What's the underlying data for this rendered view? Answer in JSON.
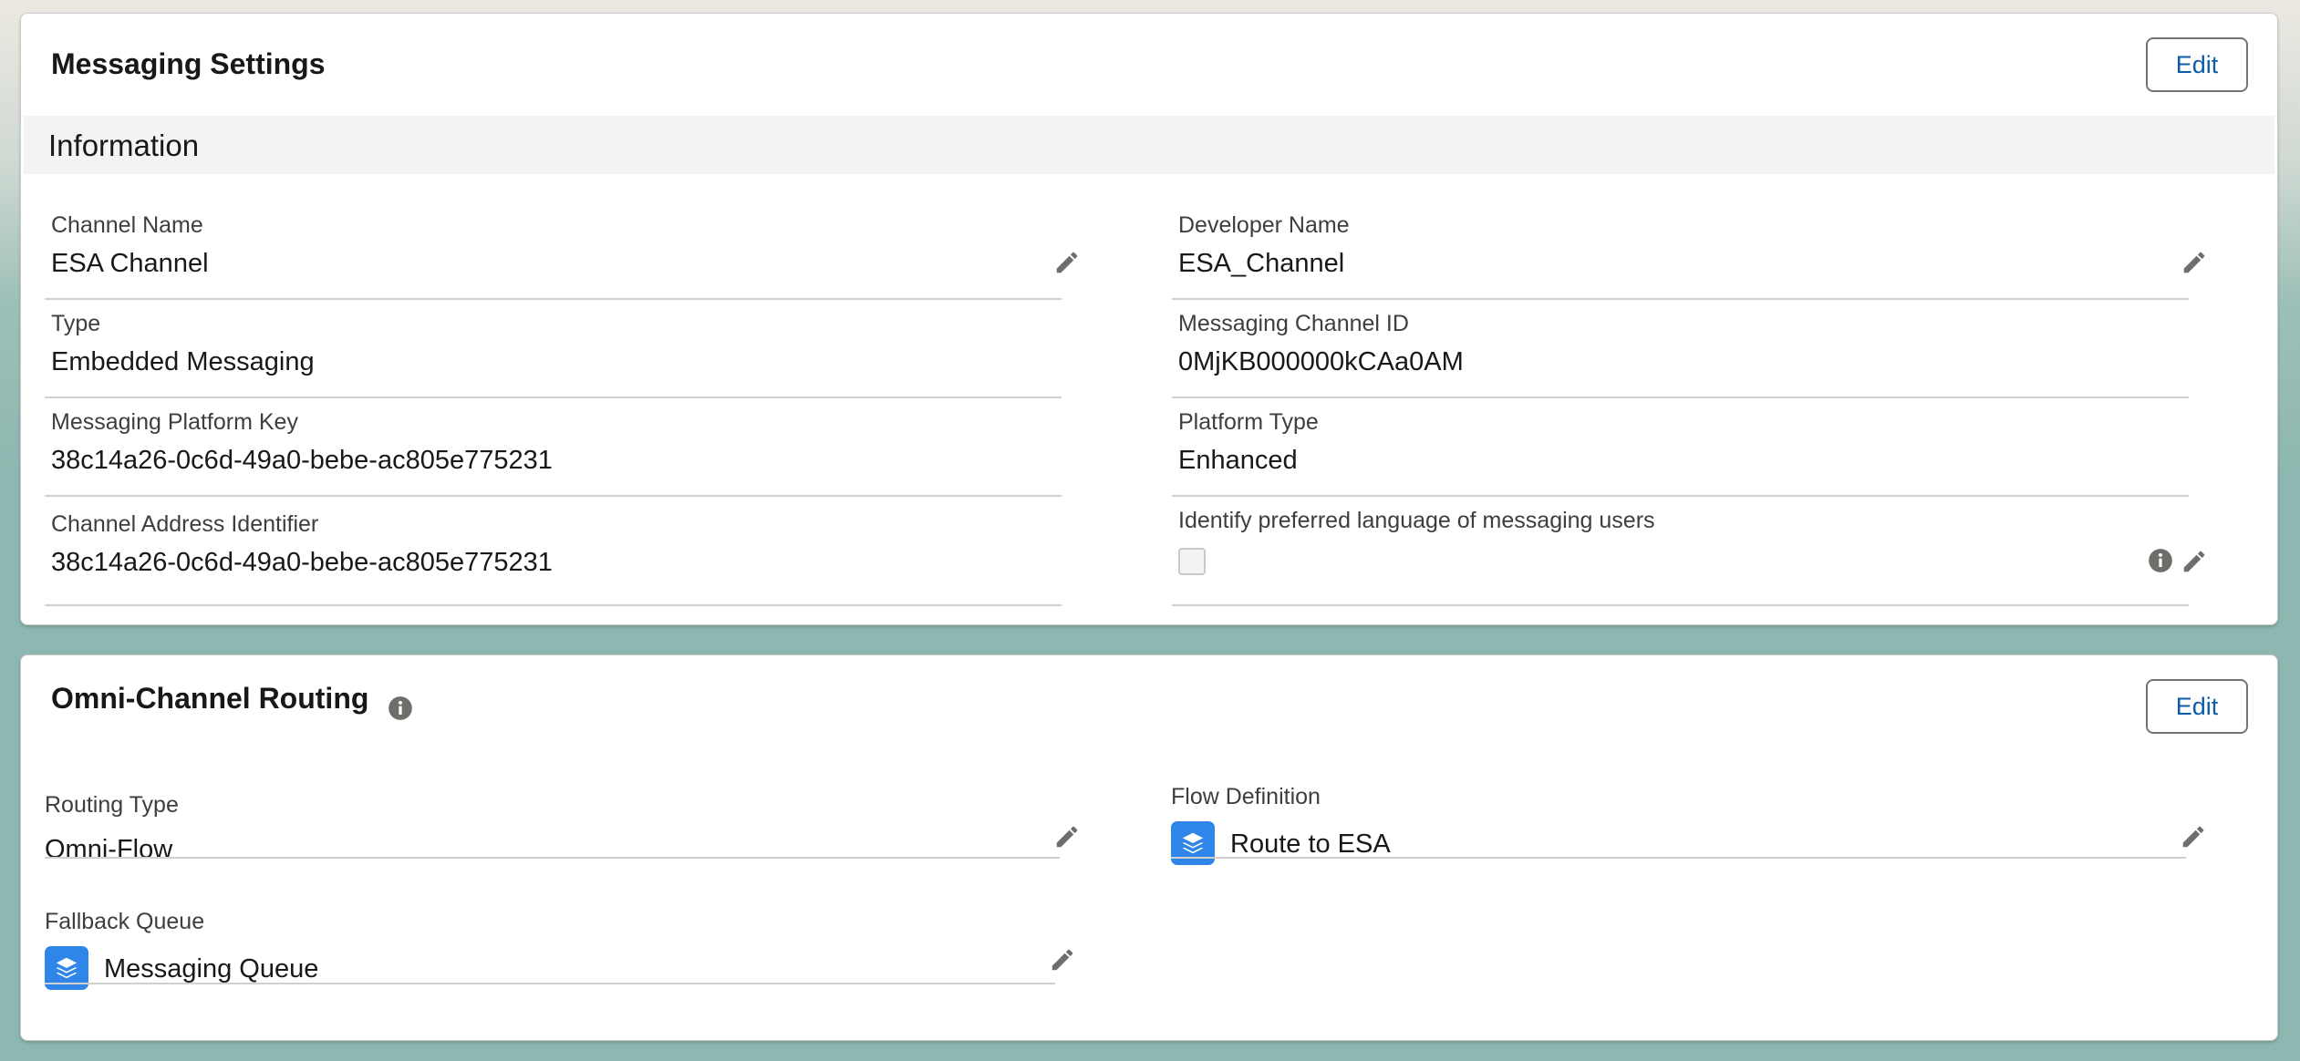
{
  "messaging_settings": {
    "title": "Messaging Settings",
    "edit_label": "Edit",
    "section_title": "Information",
    "fields": {
      "channel_name": {
        "label": "Channel Name",
        "value": "ESA Channel"
      },
      "developer_name": {
        "label": "Developer Name",
        "value": "ESA_Channel"
      },
      "type": {
        "label": "Type",
        "value": "Embedded Messaging"
      },
      "messaging_channel_id": {
        "label": "Messaging Channel ID",
        "value": "0MjKB000000kCAa0AM"
      },
      "messaging_platform_key": {
        "label": "Messaging Platform Key",
        "value": "38c14a26-0c6d-49a0-bebe-ac805e775231"
      },
      "platform_type": {
        "label": "Platform Type",
        "value": "Enhanced"
      },
      "channel_address_identifier": {
        "label": "Channel Address Identifier",
        "value": "38c14a26-0c6d-49a0-bebe-ac805e775231"
      },
      "identify_preferred_language": {
        "label": "Identify preferred language of messaging users",
        "checked": false
      }
    }
  },
  "omni_channel_routing": {
    "title": "Omni-Channel Routing",
    "edit_label": "Edit",
    "fields": {
      "routing_type": {
        "label": "Routing Type",
        "value": "Omni-Flow"
      },
      "flow_definition": {
        "label": "Flow Definition",
        "value": "Route to ESA",
        "icon": "stack-icon"
      },
      "fallback_queue": {
        "label": "Fallback Queue",
        "value": "Messaging Queue",
        "icon": "stack-icon"
      }
    }
  },
  "colors": {
    "accent": "#0b5cab",
    "icon_blue": "#2f85e8",
    "icon_gray": "#706e6b",
    "background_teal": "#8db7b0"
  }
}
